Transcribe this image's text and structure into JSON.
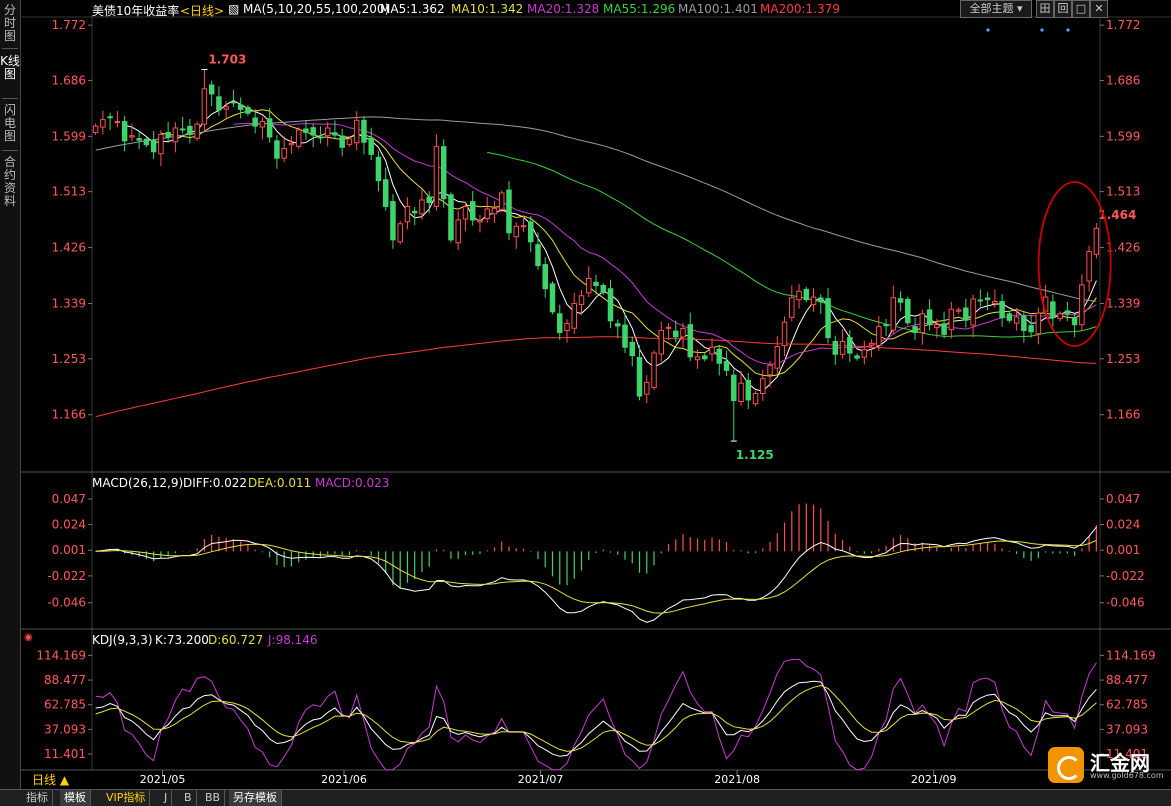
{
  "sidebar": {
    "tabs": [
      {
        "label": "分时图",
        "active": false
      },
      {
        "label": "K线图",
        "active": true
      },
      {
        "label": "闪电图",
        "active": false
      },
      {
        "label": "合约资料",
        "active": false
      }
    ]
  },
  "header": {
    "title": "美债10年收益率",
    "period": "<日线>",
    "ma_label": "MA(5,10,20,55,100,200)",
    "ma5": "MA5:1.362",
    "ma10": "MA10:1.342",
    "ma20": "MA20:1.328",
    "ma55": "MA55:1.296",
    "ma100": "MA100:1.401",
    "ma200": "MA200:1.379",
    "theme_button": "全部主题",
    "window_buttons": [
      "田",
      "回",
      "□",
      "✕"
    ]
  },
  "macd_header": {
    "label": "MACD(26,12,9)",
    "diff": "DIFF:0.022",
    "dea": "DEA:0.011",
    "macd": "MACD:0.023"
  },
  "kdj_header": {
    "label": "KDJ(9,3,3)",
    "k": "K:73.200",
    "d": "D:60.727",
    "j": "J:98.146"
  },
  "period_selector": "日线 ▲",
  "bottom_tabs": [
    {
      "label": "指标",
      "active": false
    },
    {
      "label": "模板",
      "active": true
    },
    {
      "label": "VIP指标",
      "active": false
    },
    {
      "label": "J",
      "active": false
    },
    {
      "label": "B",
      "active": false
    },
    {
      "label": "BB",
      "active": false
    },
    {
      "label": "另存模板",
      "active": true
    }
  ],
  "logo": {
    "name": "汇金网",
    "url": "www.gold678.com"
  },
  "colors": {
    "up": "#ff4f4f",
    "down": "#3fd46b",
    "ma5": "#ffffff",
    "ma10": "#e6e03c",
    "ma20": "#c83cd2",
    "ma55": "#3cd23c",
    "ma100": "#9b9b9b",
    "ma200": "#ff3c3c",
    "axis_text": "#ff5a5a",
    "annotation": "#d00000"
  },
  "chart_data": [
    {
      "type": "candlestick",
      "title": "美债10年收益率",
      "x_labels": [
        "2021/05",
        "2021/06",
        "2021/07",
        "2021/08",
        "2021/09"
      ],
      "y_ticks": [
        1.166,
        1.253,
        1.339,
        1.426,
        1.513,
        1.599,
        1.686,
        1.772
      ],
      "ylim": [
        1.08,
        1.78
      ],
      "annotations": {
        "high": "1.703",
        "low": "1.125",
        "last": "1.464"
      },
      "closes": [
        1.615,
        1.625,
        1.628,
        1.622,
        1.592,
        1.6,
        1.593,
        1.586,
        1.575,
        1.602,
        1.598,
        1.612,
        1.61,
        1.602,
        1.618,
        1.673,
        1.665,
        1.64,
        1.645,
        1.651,
        1.641,
        1.635,
        1.615,
        1.622,
        1.598,
        1.565,
        1.58,
        1.588,
        1.609,
        1.605,
        1.601,
        1.597,
        1.612,
        1.601,
        1.582,
        1.595,
        1.624,
        1.59,
        1.571,
        1.53,
        1.49,
        1.438,
        1.463,
        1.49,
        1.48,
        1.5,
        1.496,
        1.583,
        1.502,
        1.438,
        1.469,
        1.49,
        1.469,
        1.468,
        1.486,
        1.487,
        1.511,
        1.449,
        1.459,
        1.46,
        1.435,
        1.398,
        1.362,
        1.326,
        1.294,
        1.308,
        1.339,
        1.351,
        1.378,
        1.367,
        1.356,
        1.312,
        1.304,
        1.271,
        1.258,
        1.195,
        1.216,
        1.262,
        1.297,
        1.302,
        1.287,
        1.3,
        1.256,
        1.256,
        1.253,
        1.271,
        1.246,
        1.235,
        1.188,
        1.215,
        1.189,
        1.199,
        1.222,
        1.243,
        1.272,
        1.31,
        1.348,
        1.358,
        1.345,
        1.349,
        1.342,
        1.286,
        1.26,
        1.28,
        1.262,
        1.254,
        1.267,
        1.277,
        1.303,
        1.305,
        1.348,
        1.341,
        1.309,
        1.294,
        1.323,
        1.306,
        1.306,
        1.291,
        1.33,
        1.329,
        1.313,
        1.346,
        1.343,
        1.345,
        1.342,
        1.317,
        1.313,
        1.318,
        1.297,
        1.295,
        1.324,
        1.349,
        1.317,
        1.323,
        1.323,
        1.306,
        1.368,
        1.42,
        1.456
      ],
      "ma_series": [
        {
          "name": "MA5",
          "value": 1.362
        },
        {
          "name": "MA10",
          "value": 1.342
        },
        {
          "name": "MA20",
          "value": 1.328
        },
        {
          "name": "MA55",
          "value": 1.296
        },
        {
          "name": "MA100",
          "value": 1.401
        },
        {
          "name": "MA200",
          "value": 1.379
        }
      ]
    },
    {
      "type": "bar",
      "name": "MACD",
      "y_ticks": [
        0.047,
        0.024,
        0.001,
        -0.022,
        -0.046
      ],
      "ylim": [
        -0.066,
        0.055
      ]
    },
    {
      "type": "line",
      "name": "KDJ",
      "y_ticks": [
        114.169,
        88.477,
        62.785,
        37.093,
        11.401
      ],
      "ylim": [
        0,
        125
      ]
    }
  ]
}
